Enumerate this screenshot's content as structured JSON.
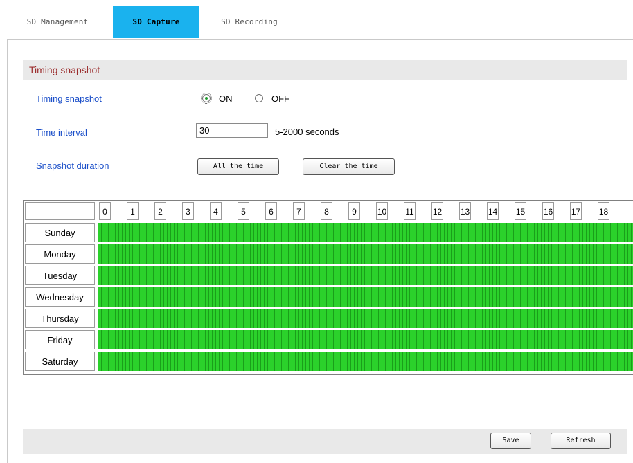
{
  "tabs": [
    {
      "label": "SD Management",
      "active": false
    },
    {
      "label": "SD Capture",
      "active": true
    },
    {
      "label": "SD Recording",
      "active": false
    }
  ],
  "section": {
    "title": "Timing snapshot"
  },
  "form": {
    "snapshot_label": "Timing snapshot",
    "on_label": "ON",
    "off_label": "OFF",
    "selected": "ON",
    "interval_label": "Time interval",
    "interval_value": "30",
    "interval_hint": "5-2000 seconds",
    "duration_label": "Snapshot duration",
    "all_time_button": "All the time",
    "clear_time_button": "Clear the time"
  },
  "schedule": {
    "hours": [
      "0",
      "1",
      "2",
      "3",
      "4",
      "5",
      "6",
      "7",
      "8",
      "9",
      "10",
      "11",
      "12",
      "13",
      "14",
      "15",
      "16",
      "17",
      "18"
    ],
    "days": [
      "Sunday",
      "Monday",
      "Tuesday",
      "Wednesday",
      "Thursday",
      "Friday",
      "Saturday"
    ],
    "all_selected": true,
    "selected_color": "#2bd12b"
  },
  "footer": {
    "save_button": "Save",
    "refresh_button": "Refresh"
  }
}
